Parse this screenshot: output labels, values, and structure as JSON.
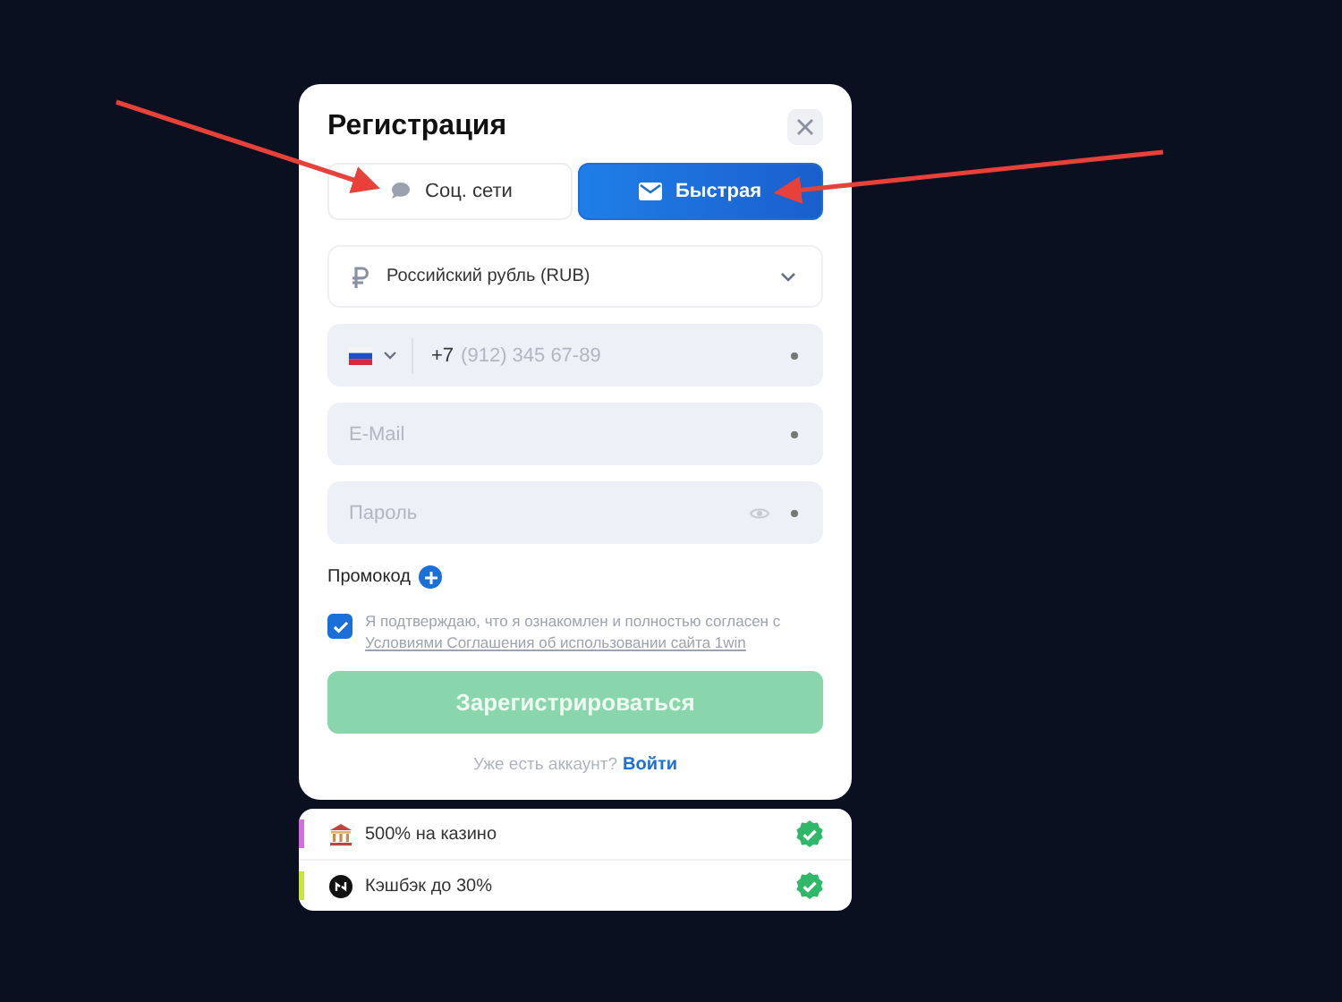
{
  "modal": {
    "title": "Регистрация",
    "tabs": [
      {
        "label": "Соц. сети",
        "kind": "chat",
        "selected": false
      },
      {
        "label": "Быстрая",
        "kind": "mail",
        "selected": true
      }
    ],
    "currency": {
      "value": "Российский рубль (RUB)"
    },
    "phone": {
      "code": "+7",
      "placeholder": "(912) 345 67-89"
    },
    "email": {
      "placeholder": "E-Mail"
    },
    "password": {
      "placeholder": "Пароль"
    },
    "promo": {
      "label": "Промокод"
    },
    "agreement": {
      "checked": true,
      "text": "Я подтверждаю, что я ознакомлен и полностью согласен с",
      "link": "Условиями Соглашения об использовании сайта 1win"
    },
    "submit": {
      "label": "Зарегистрироваться",
      "disabled": true
    },
    "login": {
      "prompt": "Уже есть аккаунт?",
      "link": "Войти"
    }
  },
  "bonuses": [
    {
      "text": "500% на казино",
      "kind": "bank",
      "color": "#d46be0",
      "done": true
    },
    {
      "text": "Кэшбэк до 30%",
      "kind": "cashback",
      "color": "#c8e63a",
      "done": true
    }
  ]
}
